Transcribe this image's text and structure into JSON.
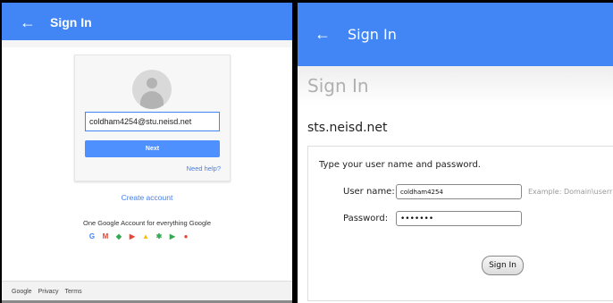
{
  "google": {
    "title": "Sign In",
    "back_icon": "←",
    "email": "coldham4254@stu.neisd.net",
    "next_label": "Next",
    "help_label": "Need help?",
    "create_label": "Create account",
    "tagline": "One Google Account for everything Google",
    "apps": [
      {
        "glyph": "G",
        "color": "#4285f4",
        "name": "google"
      },
      {
        "glyph": "M",
        "color": "#ea4335",
        "name": "gmail"
      },
      {
        "glyph": "◆",
        "color": "#34a853",
        "name": "maps"
      },
      {
        "glyph": "▶",
        "color": "#ea4335",
        "name": "youtube"
      },
      {
        "glyph": "▲",
        "color": "#fbbc05",
        "name": "drive"
      },
      {
        "glyph": "✱",
        "color": "#34a853",
        "name": "photos"
      },
      {
        "glyph": "▶",
        "color": "#34a853",
        "name": "play"
      },
      {
        "glyph": "●",
        "color": "#ea4335",
        "name": "chrome"
      }
    ],
    "footer": [
      "Google",
      "Privacy",
      "Terms"
    ]
  },
  "adfs": {
    "title": "Sign In",
    "back_icon": "←",
    "faded_title": "Sign In",
    "domain": "sts.neisd.net",
    "instruction": "Type your user name and password.",
    "username_label": "User name:",
    "username_value": "coldham4254",
    "username_example": "Example: Domain\\userr",
    "password_label": "Password:",
    "password_value": "•••••••",
    "signin_label": "Sign In"
  },
  "colors": {
    "appbar": "#4285f4",
    "link": "#427fed",
    "next_button": "#4d90fe"
  }
}
